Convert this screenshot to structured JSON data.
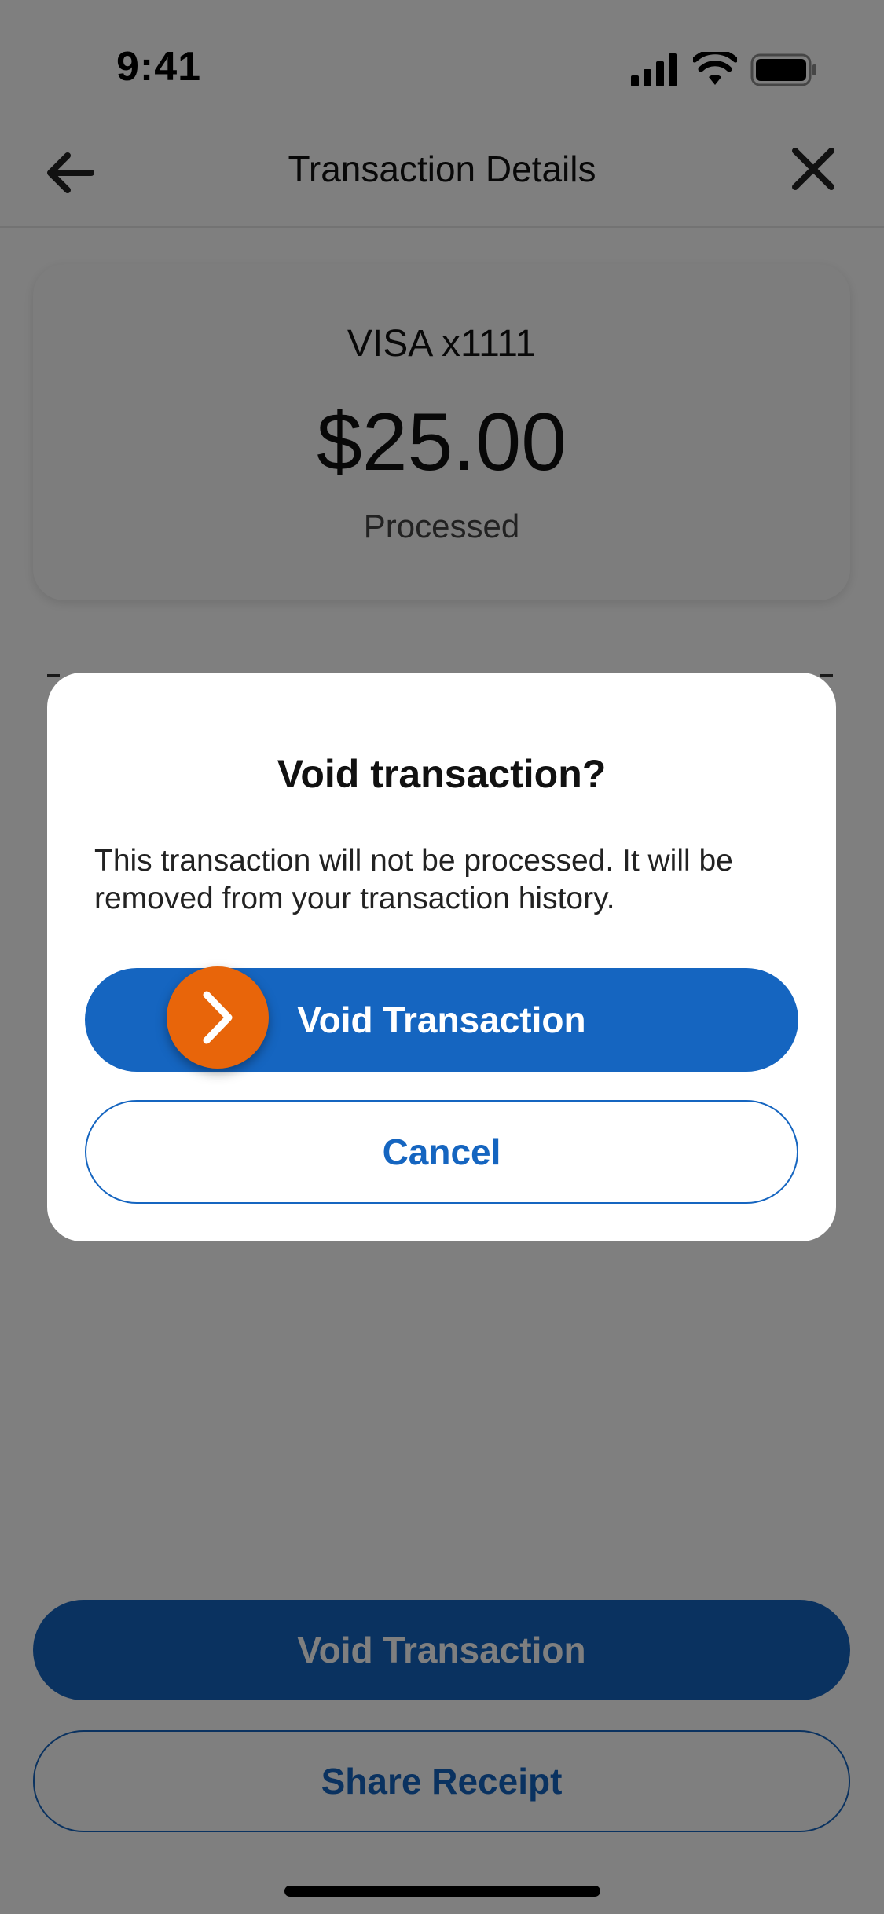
{
  "status_bar": {
    "time": "9:41",
    "icons": [
      "signal-icon",
      "wifi-icon",
      "battery-icon"
    ]
  },
  "header": {
    "title": "Transaction Details",
    "back_icon": "arrow-left-icon",
    "close_icon": "close-icon"
  },
  "summary": {
    "card_label": "VISA x1111",
    "amount": "$25.00",
    "status": "Processed"
  },
  "actions": {
    "void_label": "Void Transaction",
    "share_label": "Share Receipt"
  },
  "dialog": {
    "title": "Void transaction?",
    "body": "This transaction will not be processed. It will be removed from your transaction history.",
    "confirm_label": "Void Transaction",
    "cancel_label": "Cancel",
    "tap_hint_icon": "chevron-right-icon"
  },
  "colors": {
    "primary": "#1565c0",
    "overlay": "rgba(0,0,0,0.5)",
    "tap_indicator": "#e8650a"
  }
}
